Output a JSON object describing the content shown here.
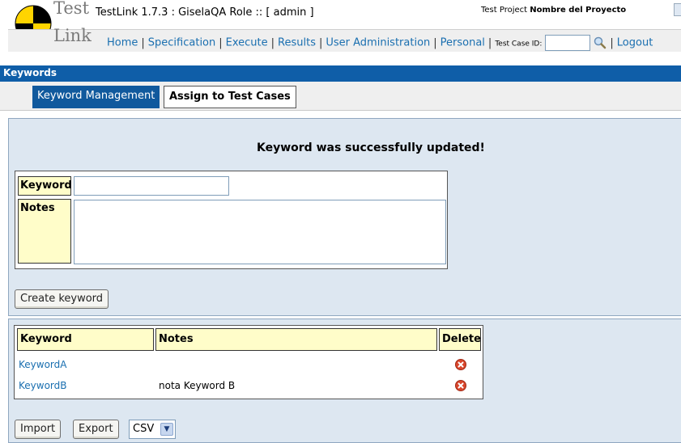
{
  "header": {
    "logo_word1": "Test",
    "logo_word2": "Link",
    "app_title": "TestLink 1.7.3 : GiselaQA Role :: [ admin ]",
    "project_label": "Test Project",
    "project_name": "Nombre del Proyecto",
    "nav": {
      "home": "Home",
      "specification": "Specification",
      "execute": "Execute",
      "results": "Results",
      "user_admin": "User Administration",
      "personal": "Personal",
      "tcid_label": "Test Case ID:",
      "logout": "Logout"
    }
  },
  "page": {
    "title": "Keywords",
    "tabs": [
      "Keyword Management",
      "Assign to Test Cases"
    ],
    "success_message": "Keyword was successfully updated!"
  },
  "form": {
    "keyword_label": "Keyword",
    "notes_label": "Notes",
    "keyword_value": "",
    "notes_value": "",
    "create_button": "Create keyword"
  },
  "table": {
    "headers": [
      "Keyword",
      "Notes",
      "Delete"
    ],
    "rows": [
      {
        "keyword": "KeywordA",
        "notes": ""
      },
      {
        "keyword": "KeywordB",
        "notes": "nota Keyword B"
      }
    ]
  },
  "actions": {
    "import_button": "Import",
    "export_button": "Export",
    "format_selected": "CSV"
  },
  "colors": {
    "title_bar": "#0f5ea8",
    "panel_bg": "#dde7f1",
    "label_bg": "#fffdc9",
    "link": "#1a6fb0"
  }
}
